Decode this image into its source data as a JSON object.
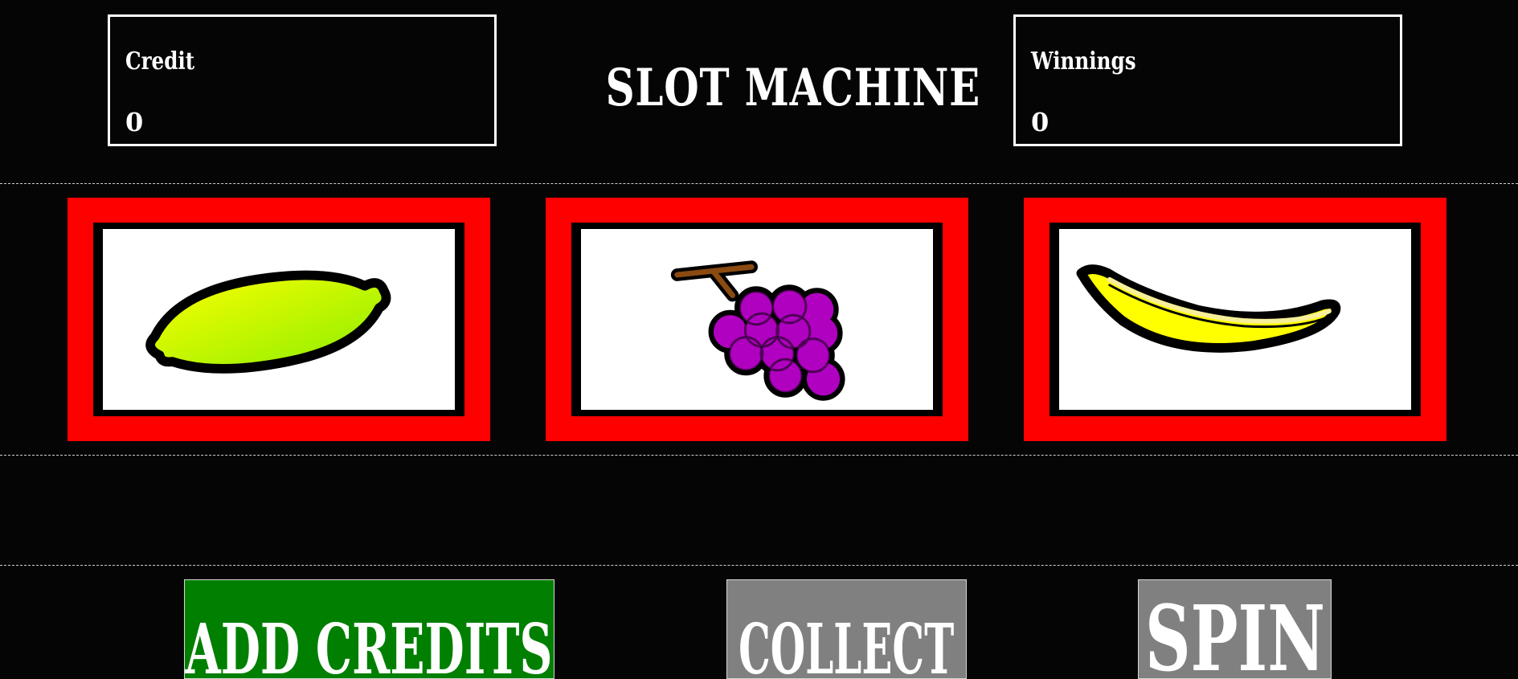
{
  "header": {
    "title": "SLOT MACHINE",
    "credit": {
      "label": "Credit",
      "value": "0"
    },
    "winnings": {
      "label": "Winnings",
      "value": "0"
    }
  },
  "reels": [
    {
      "symbol": "lemon-icon"
    },
    {
      "symbol": "grapes-icon"
    },
    {
      "symbol": "banana-icon"
    }
  ],
  "buttons": {
    "add_credits": "ADD CREDITS",
    "collect": "COLLECT",
    "spin": "SPIN"
  },
  "colors": {
    "background": "#050505",
    "reel_frame": "#ff0000",
    "add_credits_button": "#007f00",
    "disabled_button": "#808080"
  }
}
